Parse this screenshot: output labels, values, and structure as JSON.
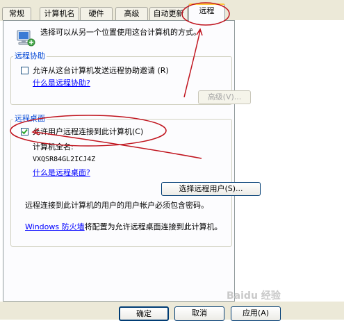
{
  "tabs": [
    {
      "label": "常规"
    },
    {
      "label": "计算机名"
    },
    {
      "label": "硬件"
    },
    {
      "label": "高级"
    },
    {
      "label": "自动更新"
    },
    {
      "label": "远程"
    }
  ],
  "intro_text": "选择可以从另一个位置使用这台计算机的方式。",
  "remote_assistance": {
    "title": "远程协助",
    "checkbox_label": "允许从这台计算机发送远程协助邀请",
    "checkbox_accel": "(R)",
    "checked": false,
    "help_link": "什么是远程协助?",
    "advanced_button": "高级(V)..."
  },
  "remote_desktop": {
    "title": "远程桌面",
    "checkbox_label": "允许用户远程连接到此计算机",
    "checkbox_accel": "(C)",
    "checked": true,
    "full_name_label": "计算机全名:",
    "full_name_value": "VXQSR84GL2ICJ4Z",
    "help_link": "什么是远程桌面?",
    "select_users_button": "选择远程用户(S)...",
    "password_note": "远程连接到此计算机的用户的用户帐户必须包含密码。",
    "firewall_link": "Windows 防火墙",
    "firewall_note": "将配置为允许远程桌面连接到此计算机。"
  },
  "dialog_buttons": {
    "ok": "确定",
    "cancel": "取消",
    "apply": "应用(A)"
  },
  "watermark": "Baidu 经验",
  "colors": {
    "annotation": "#c0141e",
    "link": "#0000ff",
    "group_title": "#0046d5"
  }
}
